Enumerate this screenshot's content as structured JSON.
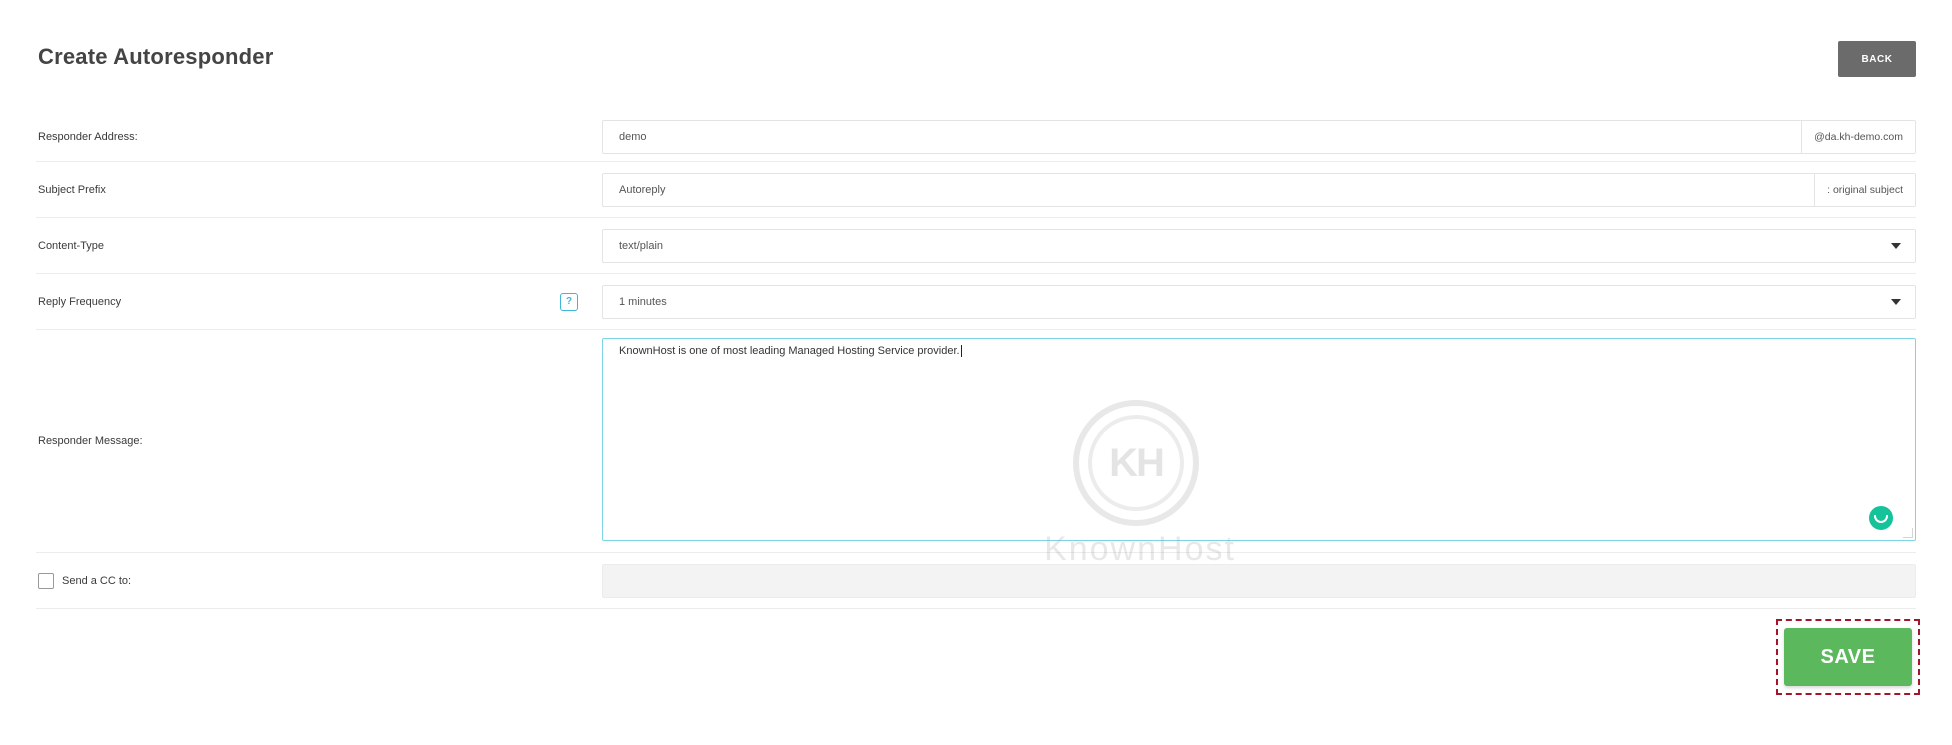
{
  "header": {
    "title": "Create Autoresponder",
    "back_label": "BACK"
  },
  "form": {
    "responder_address": {
      "label": "Responder Address:",
      "value": "demo",
      "suffix": "@da.kh-demo.com"
    },
    "subject_prefix": {
      "label": "Subject Prefix",
      "value": "Autoreply",
      "suffix": ": original subject"
    },
    "content_type": {
      "label": "Content-Type",
      "selected": "text/plain"
    },
    "reply_frequency": {
      "label": "Reply Frequency",
      "help_glyph": "?",
      "selected": "1 minutes"
    },
    "responder_message": {
      "label": "Responder Message:",
      "value": "KnownHost is one of most leading Managed Hosting Service provider."
    },
    "send_cc": {
      "label": "Send a CC to:",
      "checked": false,
      "value": ""
    }
  },
  "watermark": {
    "monogram": "KH",
    "text": "KnownHost"
  },
  "actions": {
    "save_label": "SAVE"
  },
  "colors": {
    "save_green": "#5cb85c",
    "back_gray": "#6b6b6b",
    "focus_border": "#7fd3e6",
    "highlight_dashed": "#a3162a",
    "help_blue": "#3fb6d8"
  }
}
